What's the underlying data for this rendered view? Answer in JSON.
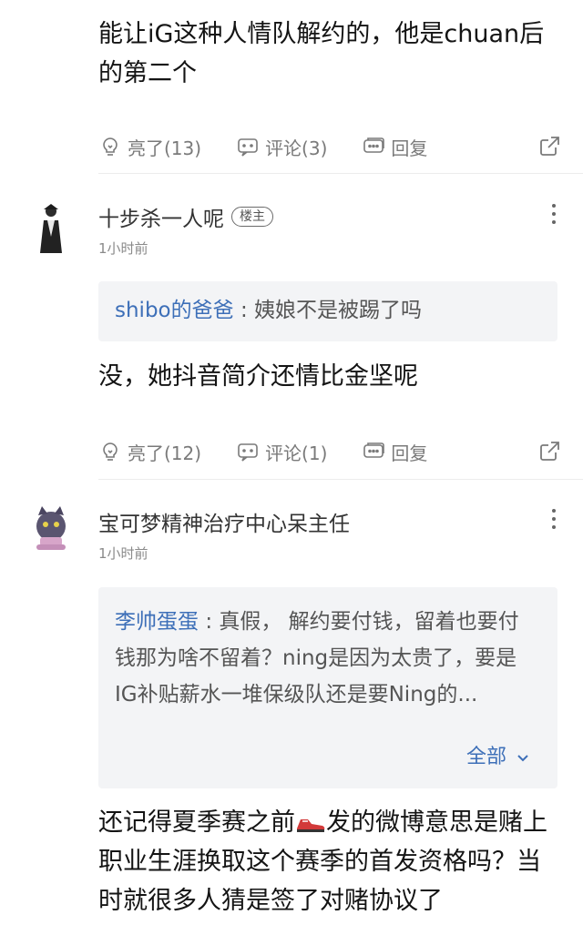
{
  "top_comment": {
    "text": "能让iG这种人情队解约的，他是chuan后的第二个",
    "actions": {
      "like": "亮了(13)",
      "comment": "评论(3)",
      "reply": "回复"
    }
  },
  "reply1": {
    "author": "十步杀一人呢",
    "badge": "楼主",
    "time": "1小时前",
    "quote_author": "shibo的爸爸",
    "quote_sep": ":",
    "quote_text": "姨娘不是被踢了吗",
    "text": "没，她抖音简介还情比金坚呢",
    "actions": {
      "like": "亮了(12)",
      "comment": "评论(1)",
      "reply": "回复"
    }
  },
  "reply2": {
    "author": "宝可梦精神治疗中心呆主任",
    "time": "1小时前",
    "quote_author": "李帅蛋蛋",
    "quote_sep": ":",
    "quote_text": "真假， 解约要付钱，留着也要付钱那为啥不留着？ning是因为太贵了，要是IG补贴薪水一堆保级队还是要Ning的...",
    "expand_label": "全部",
    "text_part1": "还记得夏季赛之前",
    "text_part2": "发的微博意思是赌上职业生涯换取这个赛季的首发资格吗？当时就很多人猜是签了对赌协议了"
  }
}
